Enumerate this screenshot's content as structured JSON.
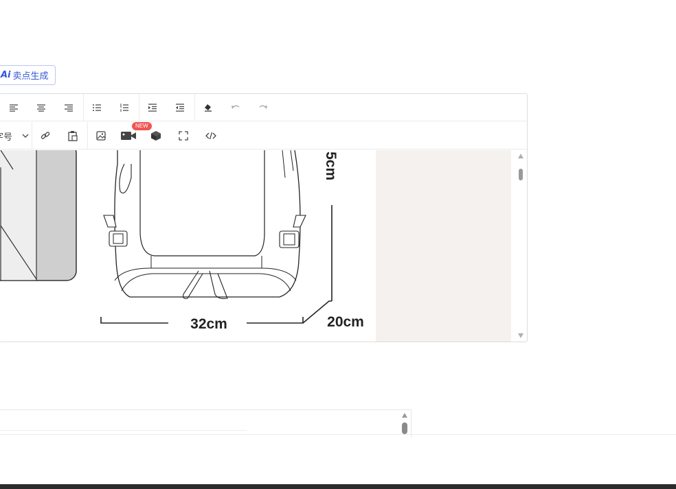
{
  "ai_button": {
    "mark": "Ai",
    "label": "卖点生成"
  },
  "toolbar": {
    "font_size_label": "字号",
    "new_badge": "NEW"
  },
  "image": {
    "width_label": "32cm",
    "depth_label": "20cm",
    "height_label_partial": "5cm"
  },
  "colors": {
    "accent": "#3557d6",
    "badge": "#f05454",
    "image_bg": "#f4f1ee"
  }
}
